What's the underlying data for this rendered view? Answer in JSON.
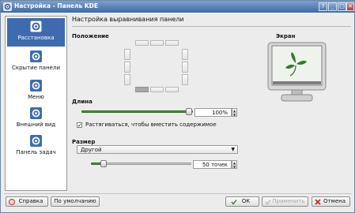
{
  "window": {
    "title": "Настройка - Панель KDE",
    "help": "?",
    "minimize": "_",
    "maximize": "□",
    "close": "✕"
  },
  "sidebar": {
    "items": [
      {
        "label": "Расстановка",
        "icon": "kde-gear-icon",
        "selected": true
      },
      {
        "label": "Скрытие панели",
        "icon": "kde-gear-icon",
        "selected": false
      },
      {
        "label": "Меню",
        "icon": "kde-gear-icon",
        "selected": false
      },
      {
        "label": "Внешний вид",
        "icon": "kde-gear-icon",
        "selected": false
      },
      {
        "label": "Панель задач",
        "icon": "kde-gear-icon",
        "selected": false
      }
    ]
  },
  "main": {
    "heading": "Настройка выравнивания панели",
    "position_label": "Положение",
    "screen_label": "Экран",
    "length_label": "Длина",
    "length_value": "100%",
    "length_fraction": 1.0,
    "stretch_checkbox": {
      "label": "Растягиваться, чтобы вместить содержимое",
      "checked": true
    },
    "size_label": "Размер",
    "size_combo": "Другой",
    "size_value": "50 точек",
    "size_fraction": 0.1
  },
  "buttons": {
    "help": "Справка",
    "defaults": "По умолчанию",
    "ok": "ОК",
    "apply": "Применить",
    "cancel": "Отмена"
  },
  "colors": {
    "selection": "#3e6bb0",
    "titlebar": "#4f79b3",
    "screen_wallpaper": "#2f7a2a"
  }
}
